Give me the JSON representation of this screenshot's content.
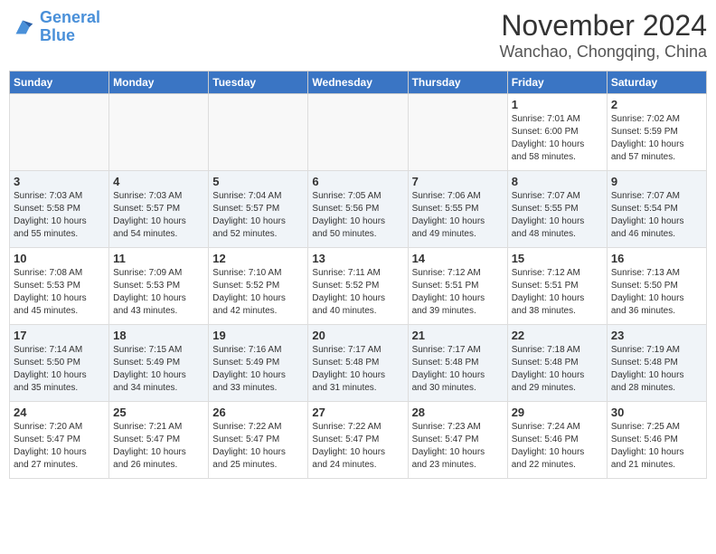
{
  "header": {
    "logo_line1": "General",
    "logo_line2": "Blue",
    "month": "November 2024",
    "location": "Wanchao, Chongqing, China"
  },
  "weekdays": [
    "Sunday",
    "Monday",
    "Tuesday",
    "Wednesday",
    "Thursday",
    "Friday",
    "Saturday"
  ],
  "weeks": [
    {
      "days": [
        {
          "date": "",
          "info": ""
        },
        {
          "date": "",
          "info": ""
        },
        {
          "date": "",
          "info": ""
        },
        {
          "date": "",
          "info": ""
        },
        {
          "date": "",
          "info": ""
        },
        {
          "date": "1",
          "info": "Sunrise: 7:01 AM\nSunset: 6:00 PM\nDaylight: 10 hours\nand 58 minutes."
        },
        {
          "date": "2",
          "info": "Sunrise: 7:02 AM\nSunset: 5:59 PM\nDaylight: 10 hours\nand 57 minutes."
        }
      ]
    },
    {
      "days": [
        {
          "date": "3",
          "info": "Sunrise: 7:03 AM\nSunset: 5:58 PM\nDaylight: 10 hours\nand 55 minutes."
        },
        {
          "date": "4",
          "info": "Sunrise: 7:03 AM\nSunset: 5:57 PM\nDaylight: 10 hours\nand 54 minutes."
        },
        {
          "date": "5",
          "info": "Sunrise: 7:04 AM\nSunset: 5:57 PM\nDaylight: 10 hours\nand 52 minutes."
        },
        {
          "date": "6",
          "info": "Sunrise: 7:05 AM\nSunset: 5:56 PM\nDaylight: 10 hours\nand 50 minutes."
        },
        {
          "date": "7",
          "info": "Sunrise: 7:06 AM\nSunset: 5:55 PM\nDaylight: 10 hours\nand 49 minutes."
        },
        {
          "date": "8",
          "info": "Sunrise: 7:07 AM\nSunset: 5:55 PM\nDaylight: 10 hours\nand 48 minutes."
        },
        {
          "date": "9",
          "info": "Sunrise: 7:07 AM\nSunset: 5:54 PM\nDaylight: 10 hours\nand 46 minutes."
        }
      ]
    },
    {
      "days": [
        {
          "date": "10",
          "info": "Sunrise: 7:08 AM\nSunset: 5:53 PM\nDaylight: 10 hours\nand 45 minutes."
        },
        {
          "date": "11",
          "info": "Sunrise: 7:09 AM\nSunset: 5:53 PM\nDaylight: 10 hours\nand 43 minutes."
        },
        {
          "date": "12",
          "info": "Sunrise: 7:10 AM\nSunset: 5:52 PM\nDaylight: 10 hours\nand 42 minutes."
        },
        {
          "date": "13",
          "info": "Sunrise: 7:11 AM\nSunset: 5:52 PM\nDaylight: 10 hours\nand 40 minutes."
        },
        {
          "date": "14",
          "info": "Sunrise: 7:12 AM\nSunset: 5:51 PM\nDaylight: 10 hours\nand 39 minutes."
        },
        {
          "date": "15",
          "info": "Sunrise: 7:12 AM\nSunset: 5:51 PM\nDaylight: 10 hours\nand 38 minutes."
        },
        {
          "date": "16",
          "info": "Sunrise: 7:13 AM\nSunset: 5:50 PM\nDaylight: 10 hours\nand 36 minutes."
        }
      ]
    },
    {
      "days": [
        {
          "date": "17",
          "info": "Sunrise: 7:14 AM\nSunset: 5:50 PM\nDaylight: 10 hours\nand 35 minutes."
        },
        {
          "date": "18",
          "info": "Sunrise: 7:15 AM\nSunset: 5:49 PM\nDaylight: 10 hours\nand 34 minutes."
        },
        {
          "date": "19",
          "info": "Sunrise: 7:16 AM\nSunset: 5:49 PM\nDaylight: 10 hours\nand 33 minutes."
        },
        {
          "date": "20",
          "info": "Sunrise: 7:17 AM\nSunset: 5:48 PM\nDaylight: 10 hours\nand 31 minutes."
        },
        {
          "date": "21",
          "info": "Sunrise: 7:17 AM\nSunset: 5:48 PM\nDaylight: 10 hours\nand 30 minutes."
        },
        {
          "date": "22",
          "info": "Sunrise: 7:18 AM\nSunset: 5:48 PM\nDaylight: 10 hours\nand 29 minutes."
        },
        {
          "date": "23",
          "info": "Sunrise: 7:19 AM\nSunset: 5:48 PM\nDaylight: 10 hours\nand 28 minutes."
        }
      ]
    },
    {
      "days": [
        {
          "date": "24",
          "info": "Sunrise: 7:20 AM\nSunset: 5:47 PM\nDaylight: 10 hours\nand 27 minutes."
        },
        {
          "date": "25",
          "info": "Sunrise: 7:21 AM\nSunset: 5:47 PM\nDaylight: 10 hours\nand 26 minutes."
        },
        {
          "date": "26",
          "info": "Sunrise: 7:22 AM\nSunset: 5:47 PM\nDaylight: 10 hours\nand 25 minutes."
        },
        {
          "date": "27",
          "info": "Sunrise: 7:22 AM\nSunset: 5:47 PM\nDaylight: 10 hours\nand 24 minutes."
        },
        {
          "date": "28",
          "info": "Sunrise: 7:23 AM\nSunset: 5:47 PM\nDaylight: 10 hours\nand 23 minutes."
        },
        {
          "date": "29",
          "info": "Sunrise: 7:24 AM\nSunset: 5:46 PM\nDaylight: 10 hours\nand 22 minutes."
        },
        {
          "date": "30",
          "info": "Sunrise: 7:25 AM\nSunset: 5:46 PM\nDaylight: 10 hours\nand 21 minutes."
        }
      ]
    }
  ]
}
